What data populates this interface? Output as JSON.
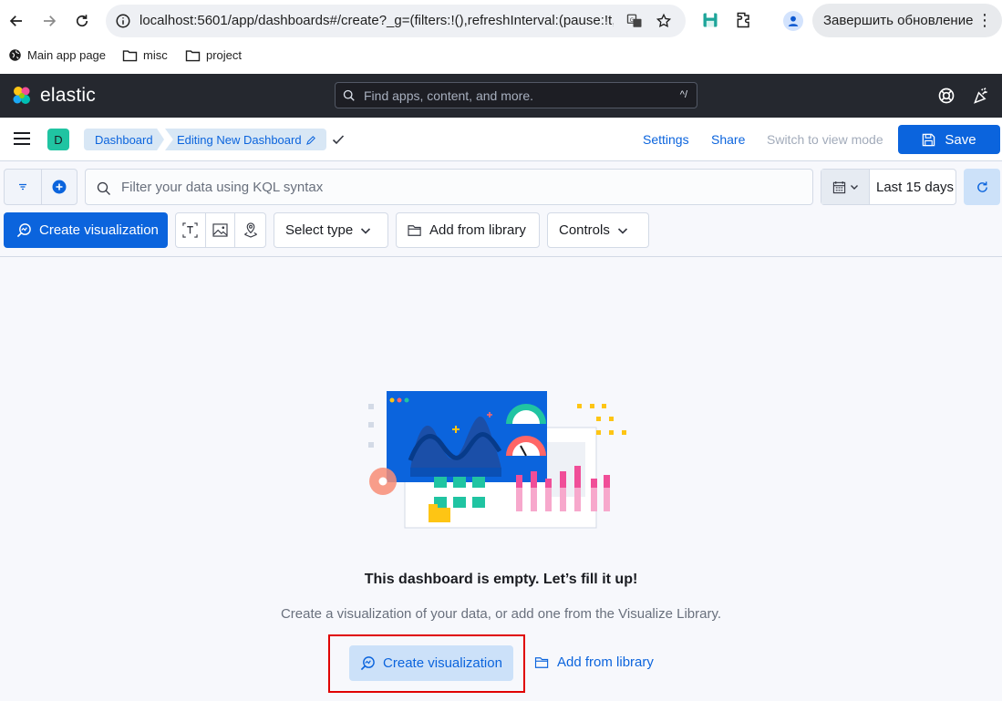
{
  "browser": {
    "url": "localhost:5601/app/dashboards#/create?_g=(filters:!(),refreshInterval:(pause:!t,v...",
    "update_button": "Завершить обновление",
    "bookmarks": [
      {
        "label": "Main app page"
      },
      {
        "label": "misc"
      },
      {
        "label": "project"
      }
    ]
  },
  "kibana_header": {
    "logo_text": "elastic",
    "search_placeholder": "Find apps, content, and more.",
    "search_shortcut": "^/"
  },
  "dashboard_nav": {
    "space_initial": "D",
    "breadcrumbs": [
      "Dashboard",
      "Editing New Dashboard"
    ],
    "settings": "Settings",
    "share": "Share",
    "switch_view_mode": "Switch to view mode",
    "save": "Save"
  },
  "query_bar": {
    "kql_placeholder": "Filter your data using KQL syntax",
    "date_range": "Last 15 days"
  },
  "toolbar": {
    "create_visualization": "Create visualization",
    "select_type": "Select type",
    "add_from_library": "Add from library",
    "controls": "Controls"
  },
  "empty_state": {
    "title": "This dashboard is empty. Let’s fill it up!",
    "description": "Create a visualization of your data, or add one from the Visualize Library.",
    "create_visualization": "Create visualization",
    "add_from_library": "Add from library"
  },
  "colors": {
    "primary": "#0b64dd",
    "header_bg": "#25282f",
    "highlight_border": "#e00000",
    "space_avatar": "#20c4a2"
  }
}
